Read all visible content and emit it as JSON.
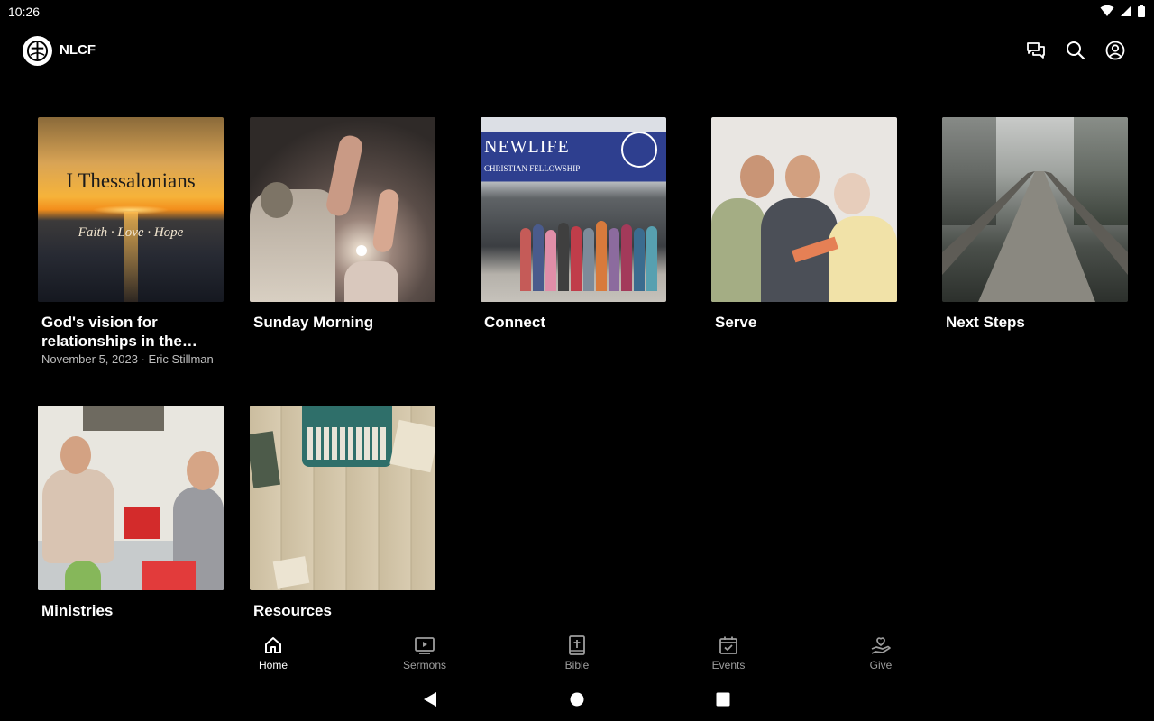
{
  "status_bar": {
    "time": "10:26",
    "icons": [
      "wifi-icon",
      "cell-signal-icon",
      "battery-icon"
    ]
  },
  "app_bar": {
    "title": "NLCF",
    "logo": "cross-logo",
    "actions": [
      "chat-icon",
      "search-icon",
      "account-icon"
    ]
  },
  "tiles": [
    {
      "title": "God's vision for relationships in the church",
      "meta": "November 5, 2023 · Eric Stillman",
      "image": "sunset-thessalonians",
      "overlay_title": "I Thessalonians",
      "overlay_sub": "Faith · Love · Hope"
    },
    {
      "title": "Sunday Morning",
      "image": "raised-hands"
    },
    {
      "title": "Connect",
      "image": "group-in-front-of-church",
      "sign_title": "NEWLIFE",
      "sign_sub": "CHRISTIAN FELLOWSHIP"
    },
    {
      "title": "Serve",
      "image": "three-women"
    },
    {
      "title": "Next Steps",
      "image": "misty-boardwalk"
    },
    {
      "title": "Ministries",
      "image": "women-with-child"
    },
    {
      "title": "Resources",
      "image": "typewriter-desk"
    }
  ],
  "bottom_nav": {
    "items": [
      {
        "label": "Home",
        "icon": "home-icon",
        "active": true
      },
      {
        "label": "Sermons",
        "icon": "play-screen-icon"
      },
      {
        "label": "Bible",
        "icon": "bible-icon"
      },
      {
        "label": "Events",
        "icon": "calendar-check-icon"
      },
      {
        "label": "Give",
        "icon": "give-hand-heart-icon"
      }
    ]
  },
  "system_nav": [
    "back-icon",
    "home-circle-icon",
    "recents-icon"
  ],
  "colors": {
    "background": "#000000",
    "text": "#ffffff",
    "muted": "#9e9e9e"
  }
}
